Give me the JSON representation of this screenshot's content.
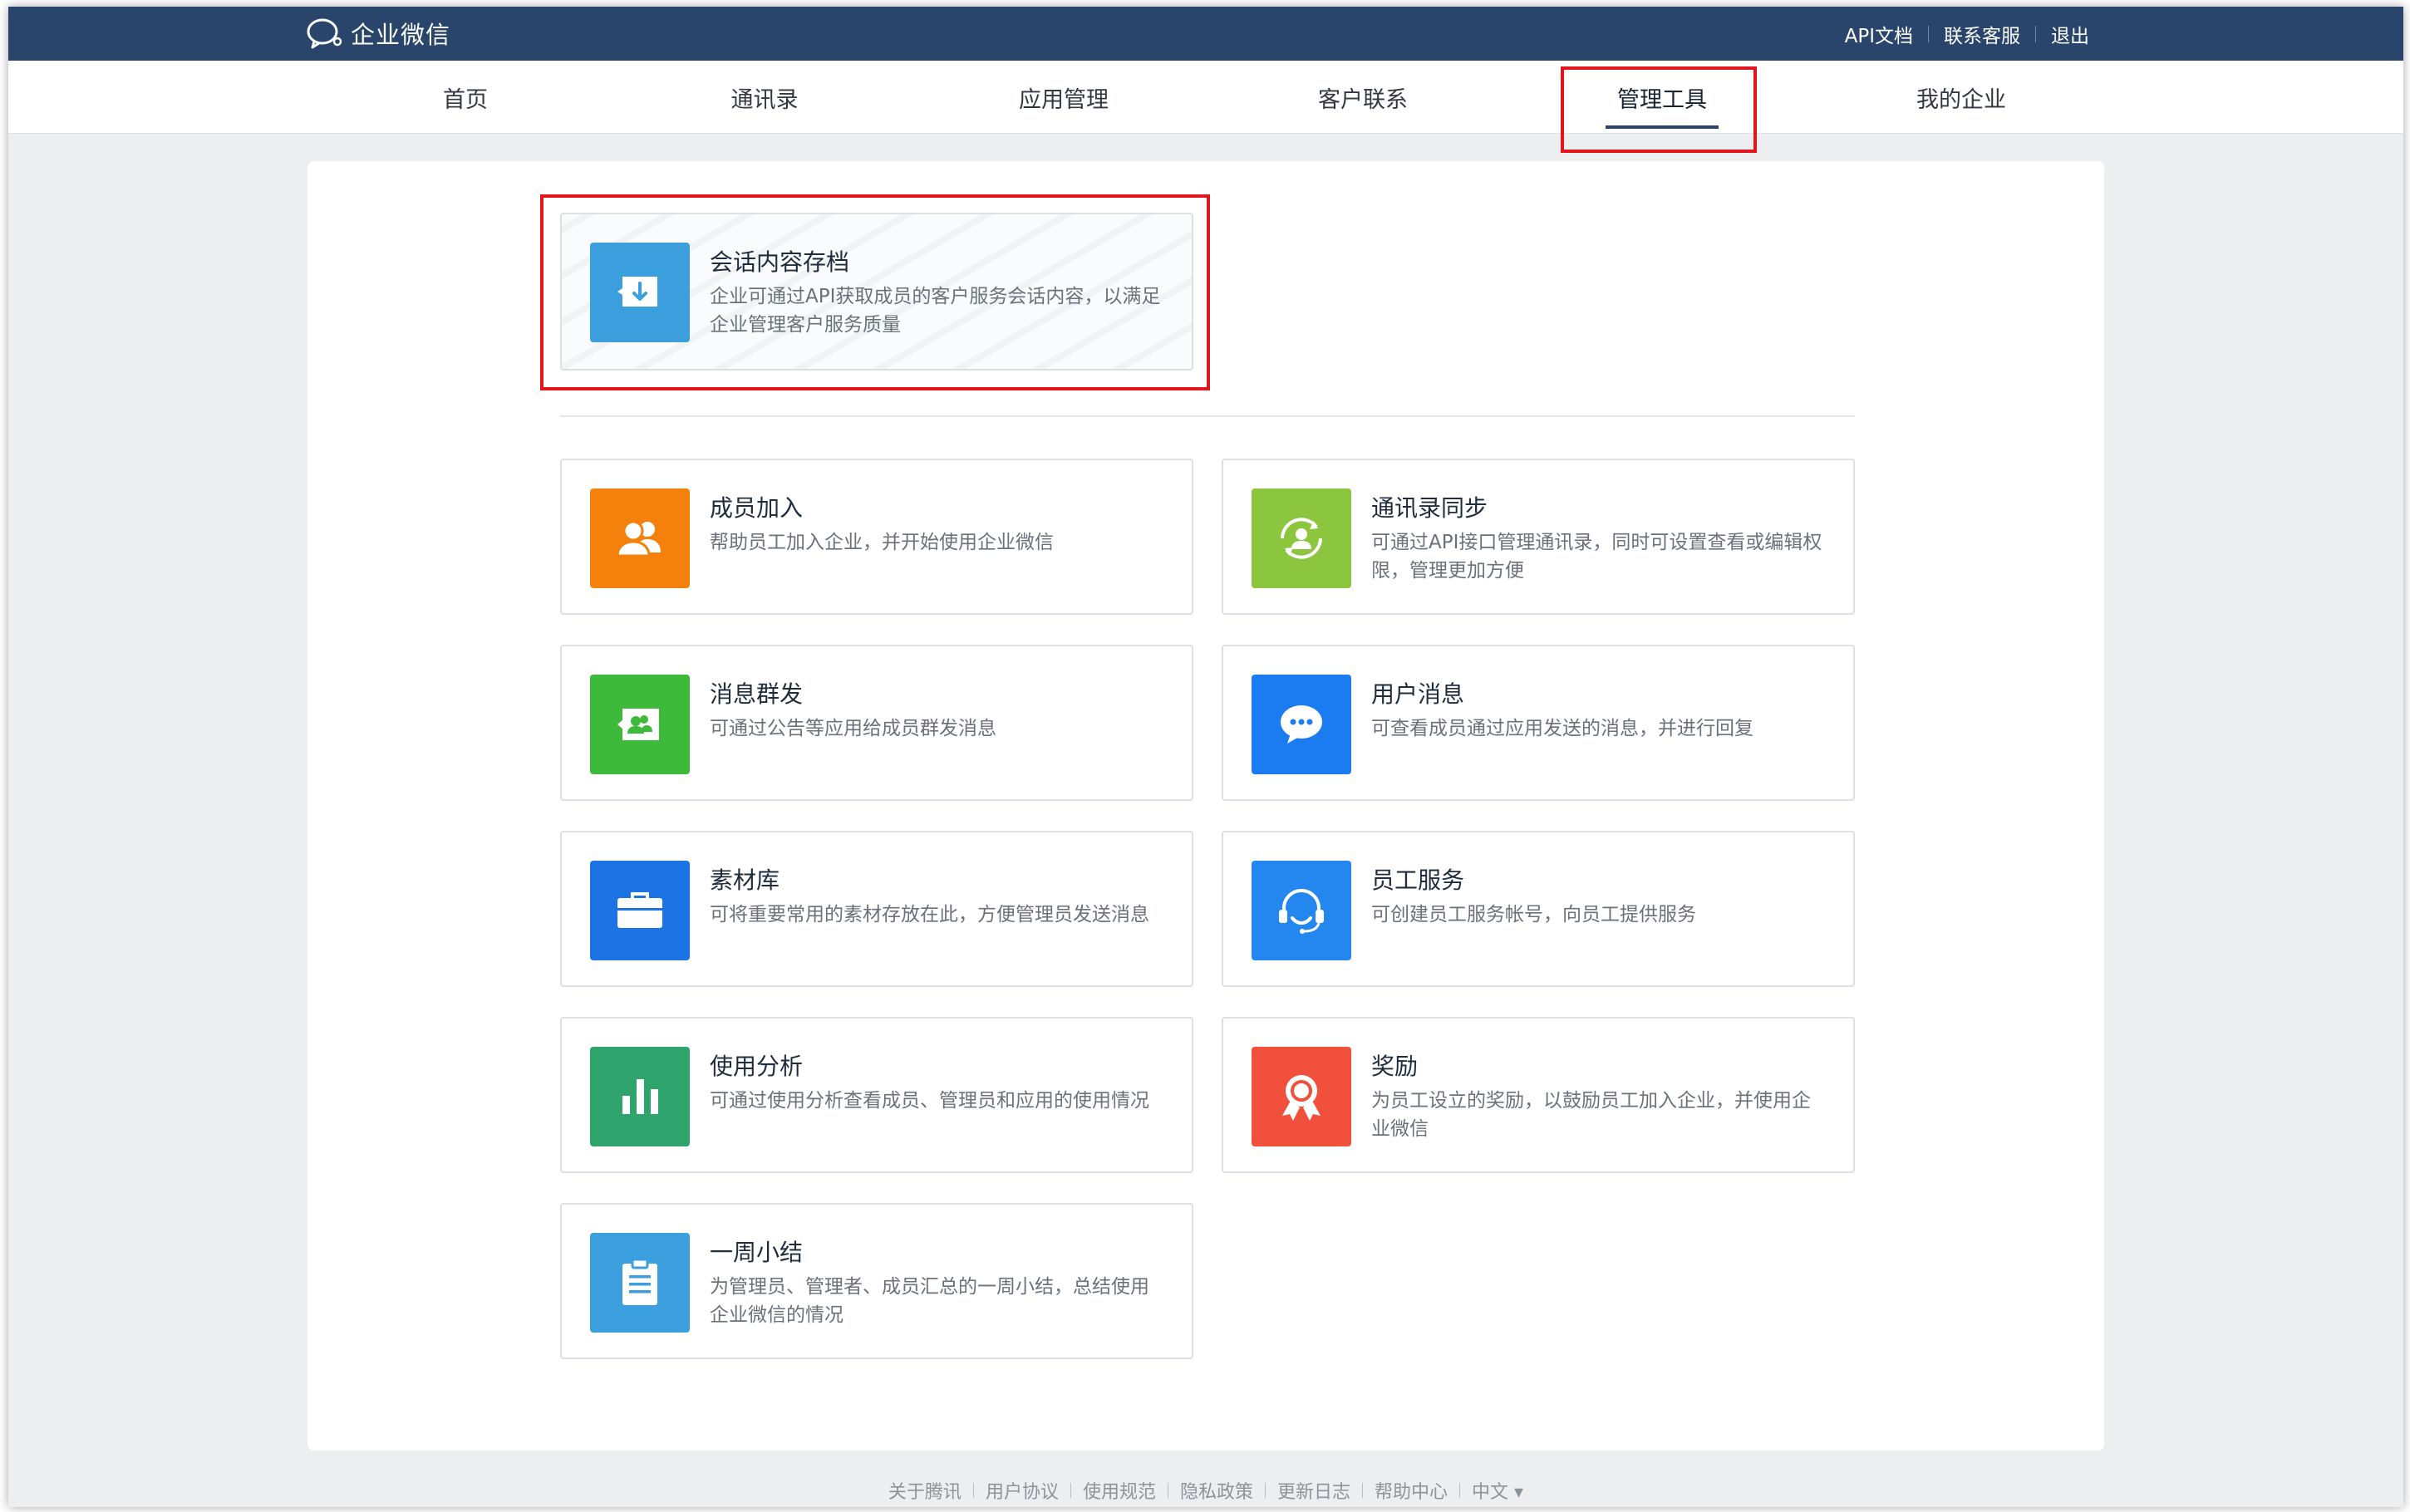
{
  "header": {
    "brand": "企业微信",
    "links": [
      "API文档",
      "联系客服",
      "退出"
    ]
  },
  "nav": {
    "items": [
      "首页",
      "通讯录",
      "应用管理",
      "客户联系",
      "管理工具",
      "我的企业"
    ],
    "active": "管理工具"
  },
  "featured": {
    "title": "会话内容存档",
    "desc": "企业可通过API获取成员的客户服务会话内容，以满足企业管理客户服务质量",
    "icon": "download-chat-icon",
    "color": "#3a9fdc"
  },
  "tools": [
    {
      "title": "成员加入",
      "desc": "帮助员工加入企业，并开始使用企业微信",
      "icon": "members-icon",
      "color": "#f5810d"
    },
    {
      "title": "通讯录同步",
      "desc": "可通过API接口管理通讯录，同时可设置查看或编辑权限，管理更加方便",
      "icon": "contact-sync-icon",
      "color": "#8cc63e"
    },
    {
      "title": "消息群发",
      "desc": "可通过公告等应用给成员群发消息",
      "icon": "broadcast-icon",
      "color": "#3dba3a"
    },
    {
      "title": "用户消息",
      "desc": "可查看成员通过应用发送的消息，并进行回复",
      "icon": "chat-bubble-icon",
      "color": "#1b7cf2"
    },
    {
      "title": "素材库",
      "desc": "可将重要常用的素材存放在此，方便管理员发送消息",
      "icon": "briefcase-icon",
      "color": "#1b73e6"
    },
    {
      "title": "员工服务",
      "desc": "可创建员工服务帐号，向员工提供服务",
      "icon": "headset-icon",
      "color": "#2487f0"
    },
    {
      "title": "使用分析",
      "desc": "可通过使用分析查看成员、管理员和应用的使用情况",
      "icon": "bar-chart-icon",
      "color": "#2ea46c"
    },
    {
      "title": "奖励",
      "desc": "为员工设立的奖励，以鼓励员工加入企业，并使用企业微信",
      "icon": "award-icon",
      "color": "#f0503c"
    },
    {
      "title": "一周小结",
      "desc": "为管理员、管理者、成员汇总的一周小结，总结使用企业微信的情况",
      "icon": "clipboard-icon",
      "color": "#3a9fdc"
    }
  ],
  "footer": {
    "links": [
      "关于腾讯",
      "用户协议",
      "使用规范",
      "隐私政策",
      "更新日志",
      "帮助中心",
      "中文 ▾"
    ]
  }
}
